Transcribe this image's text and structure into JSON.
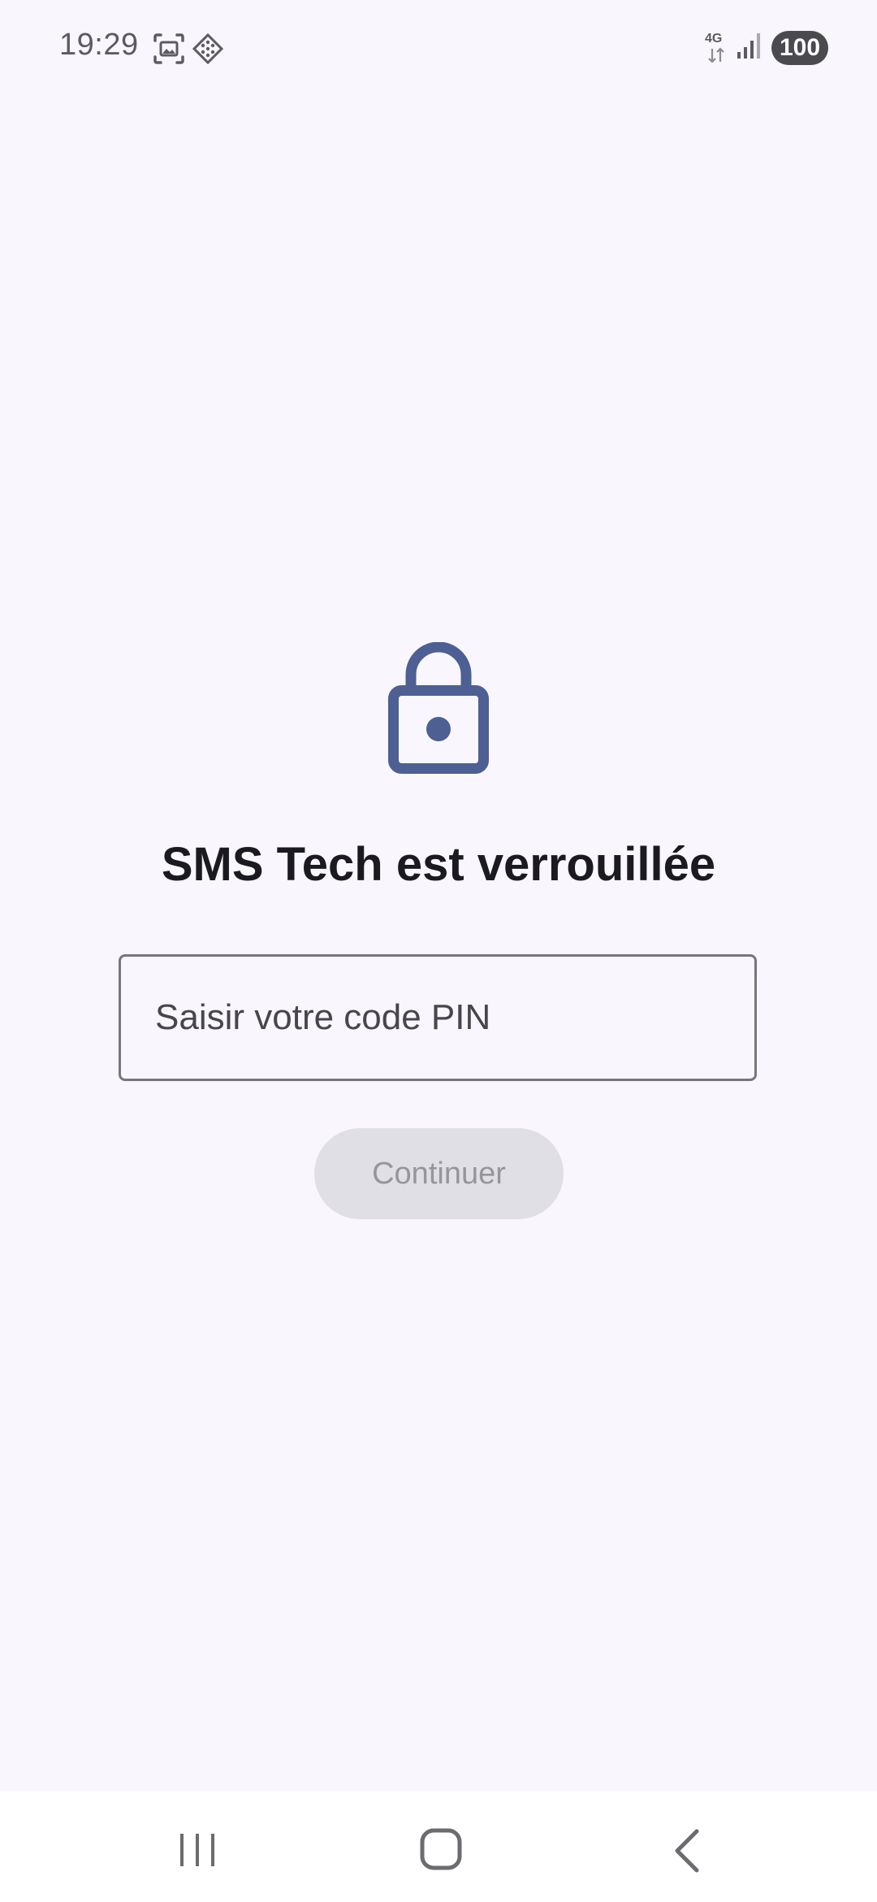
{
  "status_bar": {
    "time": "19:29",
    "network_type": "4G",
    "battery_level": "100",
    "icons": [
      "screenshot-icon",
      "diamond-grid-icon",
      "network-arrows-icon",
      "signal-icon",
      "battery-icon"
    ]
  },
  "lock_screen": {
    "icon": "lock-icon",
    "title": "SMS Tech est verrouillée",
    "pin_input": {
      "placeholder": "Saisir votre code PIN",
      "value": ""
    },
    "continue_label": "Continuer",
    "continue_enabled": false
  },
  "nav_bar": {
    "icons": [
      "recents-icon",
      "home-icon",
      "back-icon"
    ]
  },
  "colors": {
    "background": "#f9f7fd",
    "accent": "#4d5f93",
    "button_disabled_bg": "#e1dfe6",
    "button_disabled_text": "#96959b"
  }
}
